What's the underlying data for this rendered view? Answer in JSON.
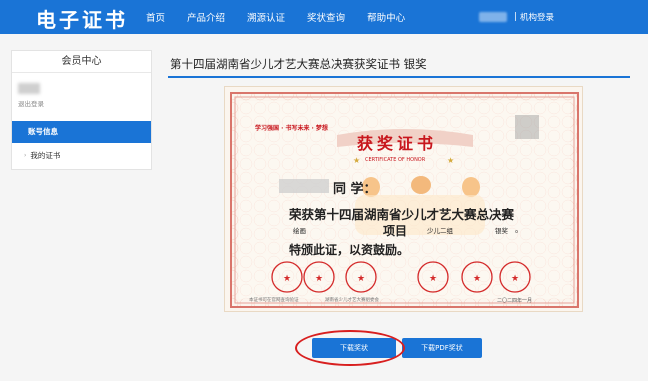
{
  "header": {
    "logo": "电子证书",
    "nav": [
      "首页",
      "产品介绍",
      "溯源认证",
      "奖状查询",
      "帮助中心"
    ],
    "user_separator": "|",
    "org_login": "机构登录"
  },
  "sidebar": {
    "title": "会员中心",
    "logout": "退出登录",
    "items": [
      {
        "label": "账号信息",
        "active": true
      },
      {
        "label": "我的证书",
        "active": false
      }
    ]
  },
  "main": {
    "title": "第十四届湖南省少儿才艺大赛总决赛获奖证书 银奖"
  },
  "certificate": {
    "slogans": "学习强国 · 书写未来 · 梦想",
    "title": "获奖证书",
    "subtitle": "CERTIFICATE OF HONOR",
    "salutation": "同 学：",
    "line1": "荣获第十四届湖南省少儿才艺大赛总决赛",
    "category": "绘画",
    "project_label": "项目",
    "group": "少儿二组",
    "award": "银奖",
    "end_mark": "。",
    "line3": "特颁此证，以资鼓励。",
    "date": "二〇二四年一月",
    "footnote1": "本证书可在官网查询验证",
    "footnote2": "湖南省少儿才艺大赛组委会"
  },
  "buttons": {
    "download_award": "下载奖状",
    "download_pdf": "下载PDF奖状"
  },
  "colors": {
    "brand": "#1a74d6",
    "cert_red": "#c8161d",
    "highlight_circle": "#d81f1f"
  }
}
